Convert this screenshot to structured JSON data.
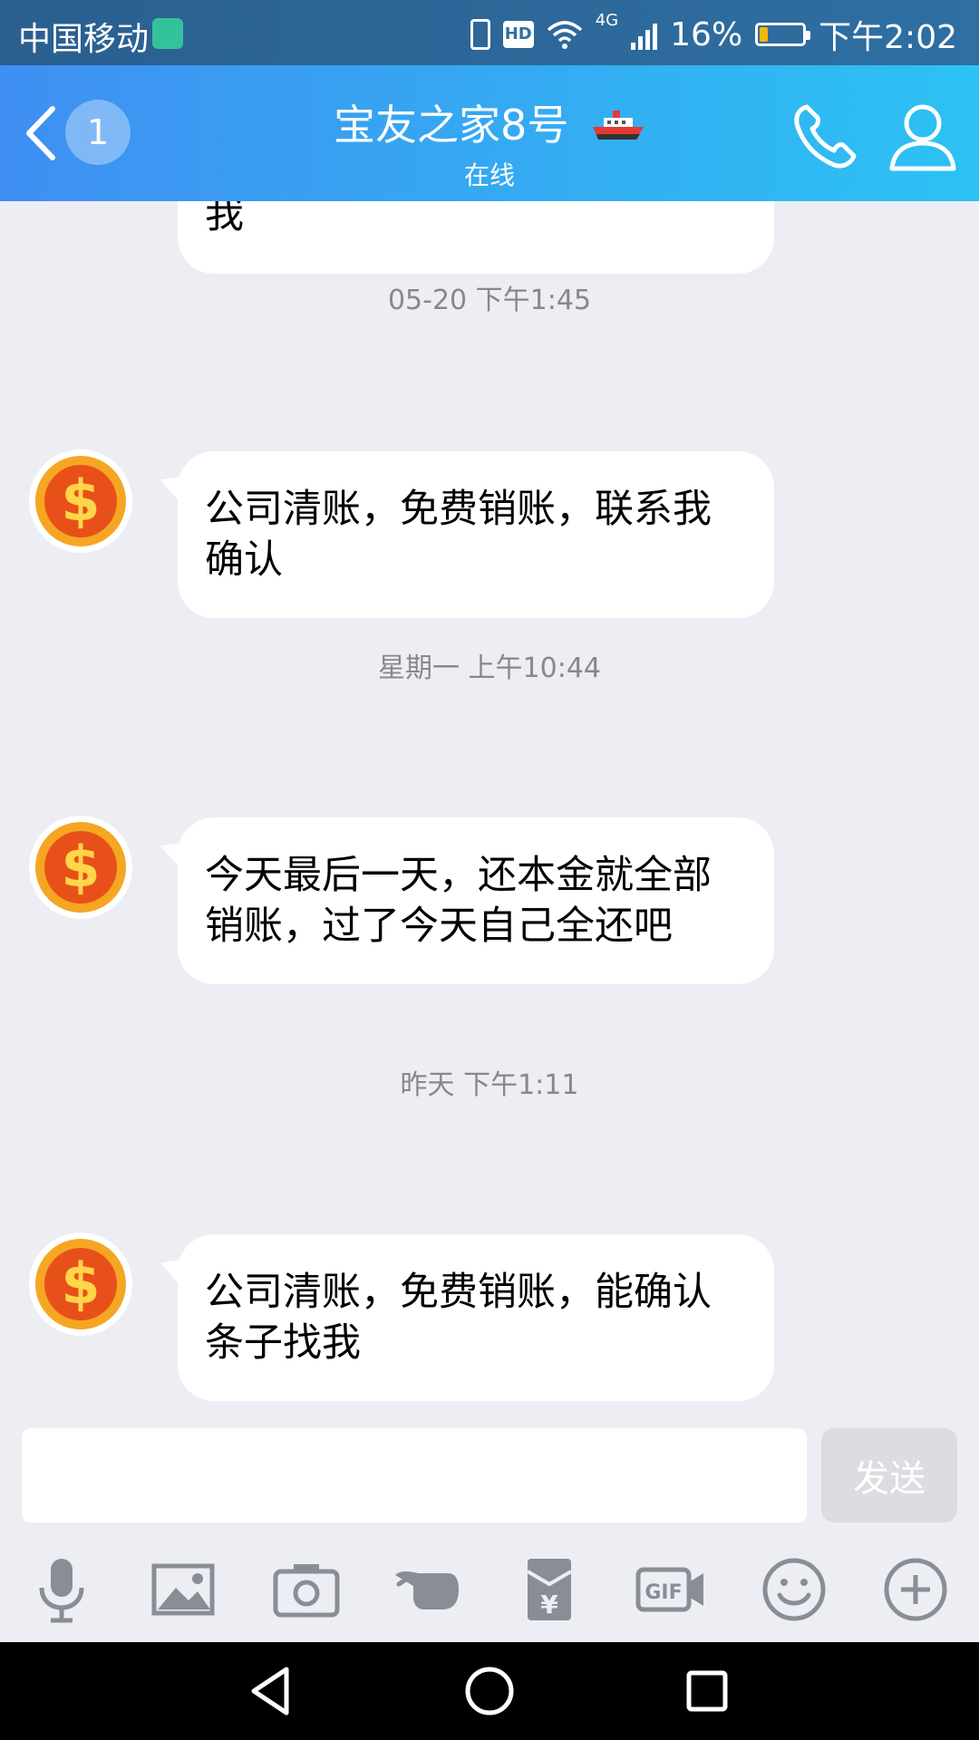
{
  "status": {
    "carrier": "中国移动",
    "network": "4G",
    "battery": "16%",
    "time": "下午2:02"
  },
  "header": {
    "unread_count": "1",
    "title": "宝友之家8号",
    "subtitle": "在线"
  },
  "chat": {
    "partial_text": "我",
    "messages": [
      {
        "timestamp": "05-20 下午1:45",
        "text": "公司清账，免费销账，联系我确认"
      },
      {
        "timestamp": "星期一 上午10:44",
        "text": "今天最后一天，还本金就全部销账，过了今天自己全还吧"
      },
      {
        "timestamp": "昨天 下午1:11",
        "text": "公司清账，免费销账，能确认条子找我"
      }
    ]
  },
  "composer": {
    "input_value": "",
    "send_label": "发送"
  },
  "tools": {
    "icons": [
      "microphone-icon",
      "image-icon",
      "camera-icon",
      "poke-icon",
      "red-packet-icon",
      "gif-icon",
      "emoji-icon",
      "plus-icon"
    ]
  },
  "colors": {
    "header_start": "#3f8ff2",
    "header_end": "#2cc2f3",
    "chat_bg": "#eceef3",
    "icon_gray": "#8a8d96"
  }
}
